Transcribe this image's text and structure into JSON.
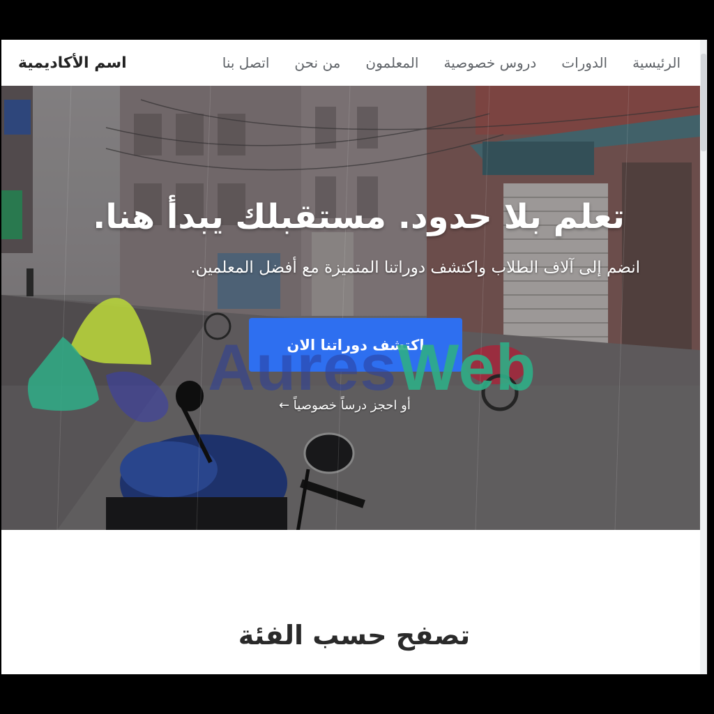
{
  "navbar": {
    "brand": "اسم الأكاديمية",
    "items": [
      {
        "label": "الرئيسية"
      },
      {
        "label": "الدورات"
      },
      {
        "label": "دروس خصوصية"
      },
      {
        "label": "المعلمون"
      },
      {
        "label": "من نحن"
      },
      {
        "label": "اتصل بنا"
      }
    ]
  },
  "hero": {
    "title": "تعلم بلا حدود. مستقبلك يبدأ هنا.",
    "subtitle": "انضم إلى آلاف الطلاب واكتشف دوراتنا المتميزة مع أفضل المعلمين.",
    "cta_label": "اكتشف دوراتنا الان",
    "private_link_label": "أو احجز درساً خصوصياً ←",
    "background_icon": "rainy-street-photo"
  },
  "watermark": {
    "part1": "Aures",
    "part2": "Web"
  },
  "categories": {
    "title": "تصفح حسب الفئة"
  },
  "colors": {
    "accent": "#2e6ff0",
    "watermark_blue": "#2b3f9c",
    "watermark_green": "#2fae87",
    "watermark_lime": "#b7d33c"
  }
}
